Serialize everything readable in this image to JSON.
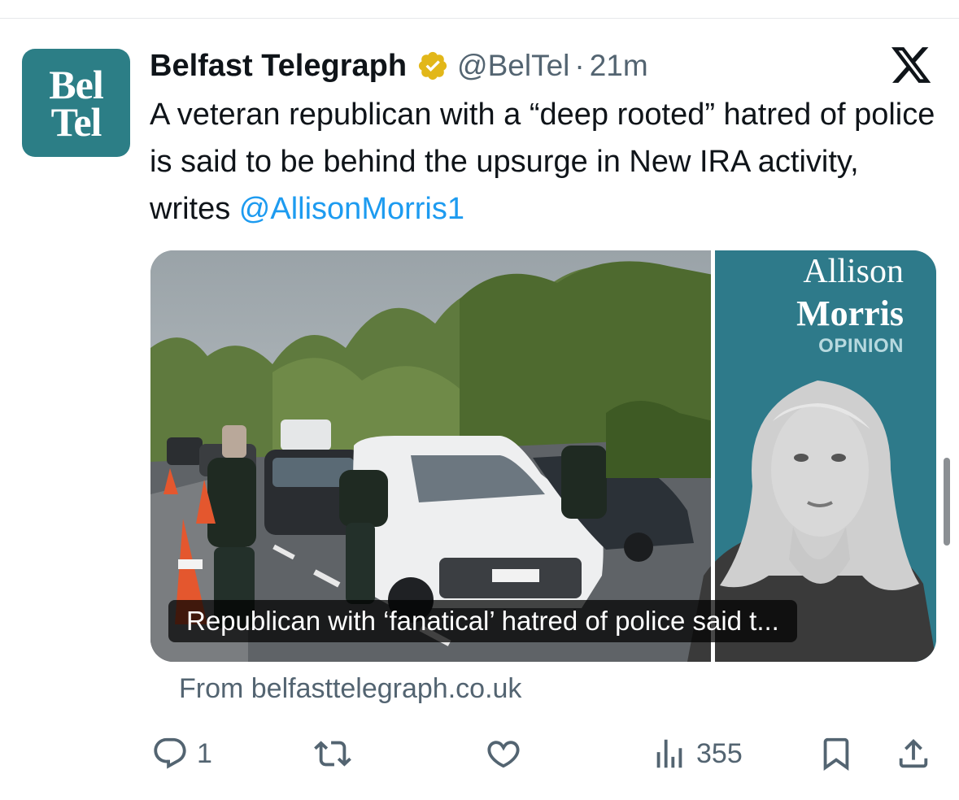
{
  "tweet": {
    "author": {
      "avatar_text": [
        "Bel",
        "Tel"
      ],
      "display_name": "Belfast Telegraph",
      "handle": "@BelTel",
      "separator": "·",
      "timestamp": "21m",
      "verified_color": "#e2b719"
    },
    "text": {
      "body": "A veteran republican with a “deep rooted” hatred of police is said to be behind the upsurge in New IRA activity, writes ",
      "mention": "@AllisonMorris1"
    },
    "card": {
      "author_first": "Allison",
      "author_last": "Morris",
      "section_label": "OPINION",
      "title": "Republican with ‘fanatical’ hatred of police said t...",
      "source": "From belfasttelegraph.co.uk"
    },
    "actions": {
      "reply_count": "1",
      "retweet_count": "",
      "like_count": "",
      "views_count": "355"
    }
  },
  "colors": {
    "accent": "#1d9bf0",
    "secondary_text": "#536471",
    "brand_teal": "#2c7e86"
  },
  "icons": [
    "verified-badge-icon",
    "x-logo-icon",
    "reply-icon",
    "retweet-icon",
    "like-icon",
    "views-icon",
    "bookmark-icon",
    "share-icon"
  ]
}
